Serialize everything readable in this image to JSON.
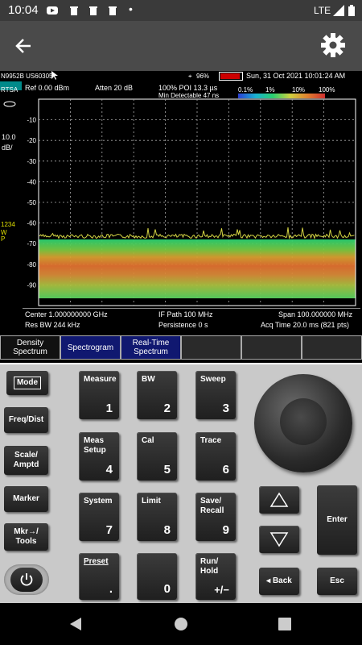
{
  "status_bar": {
    "time": "10:04",
    "dot": "•",
    "network": "LTE"
  },
  "instrument": {
    "model": "N9952B US603",
    "serial": "05",
    "battery": "96%",
    "date": "Sun, 31 Oct 2021 10:01:24 AM",
    "mode": "RTSA",
    "ref": "Ref 0.00 dBm",
    "atten": "Atten 20 dB",
    "poi": "100% POI 13.3 µs",
    "min_detect": "Min Detectable 47 ns",
    "scale_value": "10.0",
    "scale_unit": "dB/",
    "trace_ids": "1234",
    "trace_wp": "W\nP",
    "persist_scale": [
      "0.1%",
      "1%",
      "10%",
      "100%"
    ],
    "y_ticks": [
      "-10",
      "-20",
      "-30",
      "-40",
      "-50",
      "-60",
      "-70",
      "-80",
      "-90"
    ],
    "center": "Center 1.000000000 GHz",
    "rbw": "Res BW 244 kHz",
    "if_path": "IF Path 100 MHz",
    "persistence": "Persistence 0  s",
    "span": "Span 100.000000 MHz",
    "acq_time": "Acq Time 20.0 ms (821 pts)"
  },
  "softkeys": [
    {
      "label": "Density Spectrum"
    },
    {
      "label": "Spectrogram"
    },
    {
      "label": "Real-Time Spectrum"
    },
    {
      "label": ""
    },
    {
      "label": ""
    },
    {
      "label": ""
    }
  ],
  "panel": {
    "left_keys": {
      "mode": "Mode",
      "freq": "Freq/Dist",
      "scale": "Scale/\nAmptd",
      "marker": "Marker",
      "mkr": "Mkr→/\nTools"
    },
    "keypad": [
      {
        "label": "Measure",
        "num": "1"
      },
      {
        "label": "BW",
        "num": "2"
      },
      {
        "label": "Sweep",
        "num": "3"
      },
      {
        "label": "Meas\nSetup",
        "num": "4"
      },
      {
        "label": "Cal",
        "num": "5"
      },
      {
        "label": "Trace",
        "num": "6"
      },
      {
        "label": "System",
        "num": "7"
      },
      {
        "label": "Limit",
        "num": "8"
      },
      {
        "label": "Save/\nRecall",
        "num": "9"
      },
      {
        "label": "Preset",
        "num": "."
      },
      {
        "label": "",
        "num": "0"
      },
      {
        "label": "Run/\nHold",
        "num": "+/−"
      }
    ],
    "enter": "Enter",
    "back": "◂ Back",
    "esc": "Esc"
  },
  "colors": {
    "accent_trace": "#d4d444",
    "persistence_low": "#22a86a",
    "persistence_high": "#e06030"
  }
}
